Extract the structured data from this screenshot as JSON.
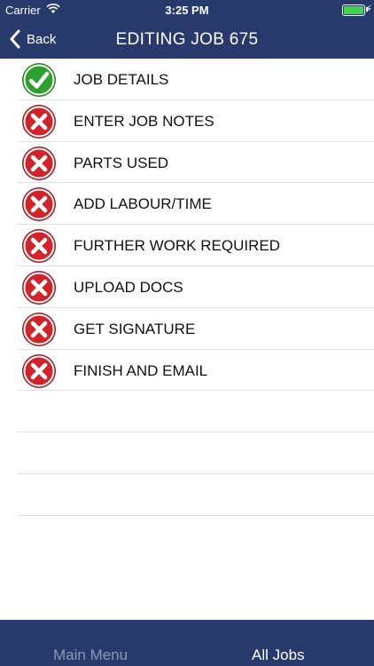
{
  "status_bar": {
    "carrier": "Carrier",
    "time": "3:25 PM"
  },
  "nav": {
    "back_label": "Back",
    "title": "EDITING JOB 675"
  },
  "items": [
    {
      "label": "JOB DETAILS",
      "state": "complete",
      "icon": "check-icon"
    },
    {
      "label": "ENTER JOB NOTES",
      "state": "incomplete",
      "icon": "x-circle-icon"
    },
    {
      "label": "PARTS USED",
      "state": "incomplete",
      "icon": "x-circle-icon"
    },
    {
      "label": "ADD LABOUR/TIME",
      "state": "incomplete",
      "icon": "x-circle-icon"
    },
    {
      "label": "FURTHER WORK REQUIRED",
      "state": "incomplete",
      "icon": "x-circle-icon"
    },
    {
      "label": "UPLOAD DOCS",
      "state": "incomplete",
      "icon": "x-circle-icon"
    },
    {
      "label": "GET SIGNATURE",
      "state": "incomplete",
      "icon": "x-circle-icon"
    },
    {
      "label": "FINISH AND EMAIL",
      "state": "incomplete",
      "icon": "x-circle-icon"
    }
  ],
  "tabbar": {
    "main_menu": "Main Menu",
    "all_jobs": "All Jobs"
  },
  "colors": {
    "nav_bg": "#283a6b",
    "complete": "#2ea02e",
    "incomplete": "#d2232a",
    "tab_inactive": "#8c97b7"
  }
}
